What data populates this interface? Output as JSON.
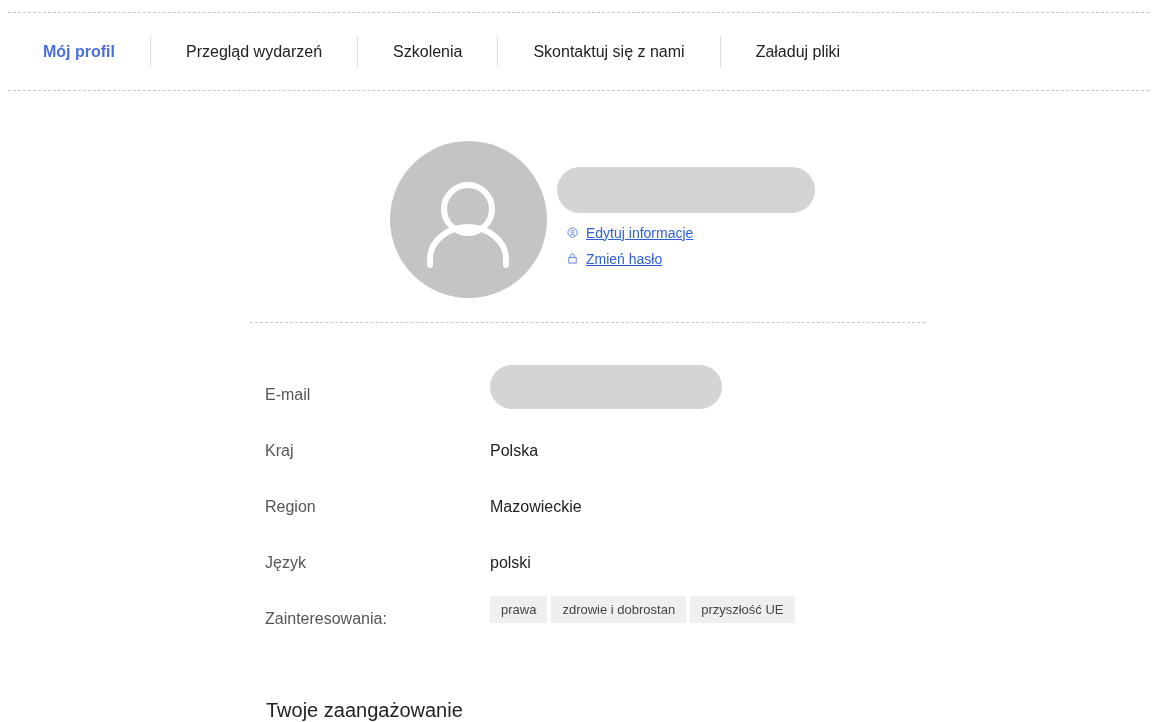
{
  "tabs": [
    {
      "label": "Mój profil",
      "selected": true
    },
    {
      "label": "Przegląd wydarzeń",
      "selected": false
    },
    {
      "label": "Szkolenia",
      "selected": false
    },
    {
      "label": "Skontaktuj się z nami",
      "selected": false
    },
    {
      "label": "Załaduj pliki",
      "selected": false
    }
  ],
  "profile": {
    "links": [
      {
        "kind": "edit",
        "label": "Edytuj informacje"
      },
      {
        "kind": "password",
        "label": "Zmień hasło"
      }
    ]
  },
  "fields": [
    {
      "label": "E-mail",
      "kind": "redacted"
    },
    {
      "label": "Kraj",
      "kind": "text",
      "value": "Polska"
    },
    {
      "label": "Region",
      "kind": "text",
      "value": "Mazowieckie"
    },
    {
      "label": "Język",
      "kind": "text",
      "value": "polski"
    },
    {
      "label": "Zainteresowania:",
      "kind": "tags",
      "tags": [
        "prawa",
        "zdrowie i dobrostan",
        "przyszłość UE"
      ]
    }
  ],
  "section_title": "Twoje zaangażowanie"
}
